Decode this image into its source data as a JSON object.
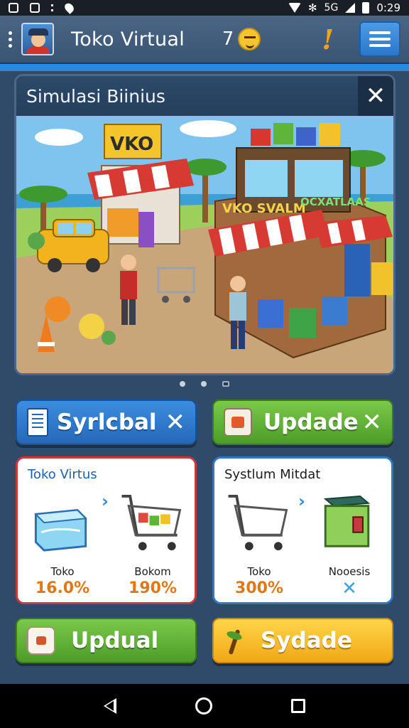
{
  "status_bar": {
    "network": "5G",
    "time": "0:29",
    "icons": [
      "notification-icon",
      "messages-icon",
      "more-icon",
      "location-icon",
      "wifi-icon",
      "bluetooth-icon",
      "signal-icon",
      "battery-icon"
    ]
  },
  "header": {
    "title": "Toko Virtual",
    "coin_count": "7",
    "icons": [
      "kebab-menu-icon",
      "avatar",
      "coin-emoji-icon",
      "alert-icon",
      "hamburger-menu-icon"
    ]
  },
  "hero": {
    "title": "Simulasi Biinius",
    "close_symbol": "✕",
    "scene": {
      "sign_left": "VKO",
      "sign_center": "VKO SVALM",
      "sign_right": "OCXATLAAS"
    }
  },
  "pager": {
    "count": 3,
    "active_index": 2
  },
  "buttons": {
    "sync": {
      "label": "Syrlcbal",
      "dismiss": "✕"
    },
    "update": {
      "label": "Updade",
      "dismiss": "✕"
    },
    "upload": {
      "label": "Updual"
    },
    "sydade": {
      "label": "Sydade"
    }
  },
  "cards": {
    "left": {
      "title": "Toko Virtus",
      "stat1_label": "Toko",
      "stat1_value": "16.0%",
      "stat2_label": "Bokom",
      "stat2_value": "190%"
    },
    "right": {
      "title": "Systlum Mitdat",
      "stat1_label": "Toko",
      "stat1_value": "300%",
      "stat2_label": "Nooesis",
      "stat2_value": "✕"
    }
  },
  "colors": {
    "background": "#2f4b69",
    "accent_blue": "#2b78c9",
    "accent_green": "#4d9c28",
    "accent_yellow": "#f0a815",
    "stat_orange": "#e07818",
    "card_red_border": "#c9383c",
    "card_blue_border": "#2f78c8"
  }
}
